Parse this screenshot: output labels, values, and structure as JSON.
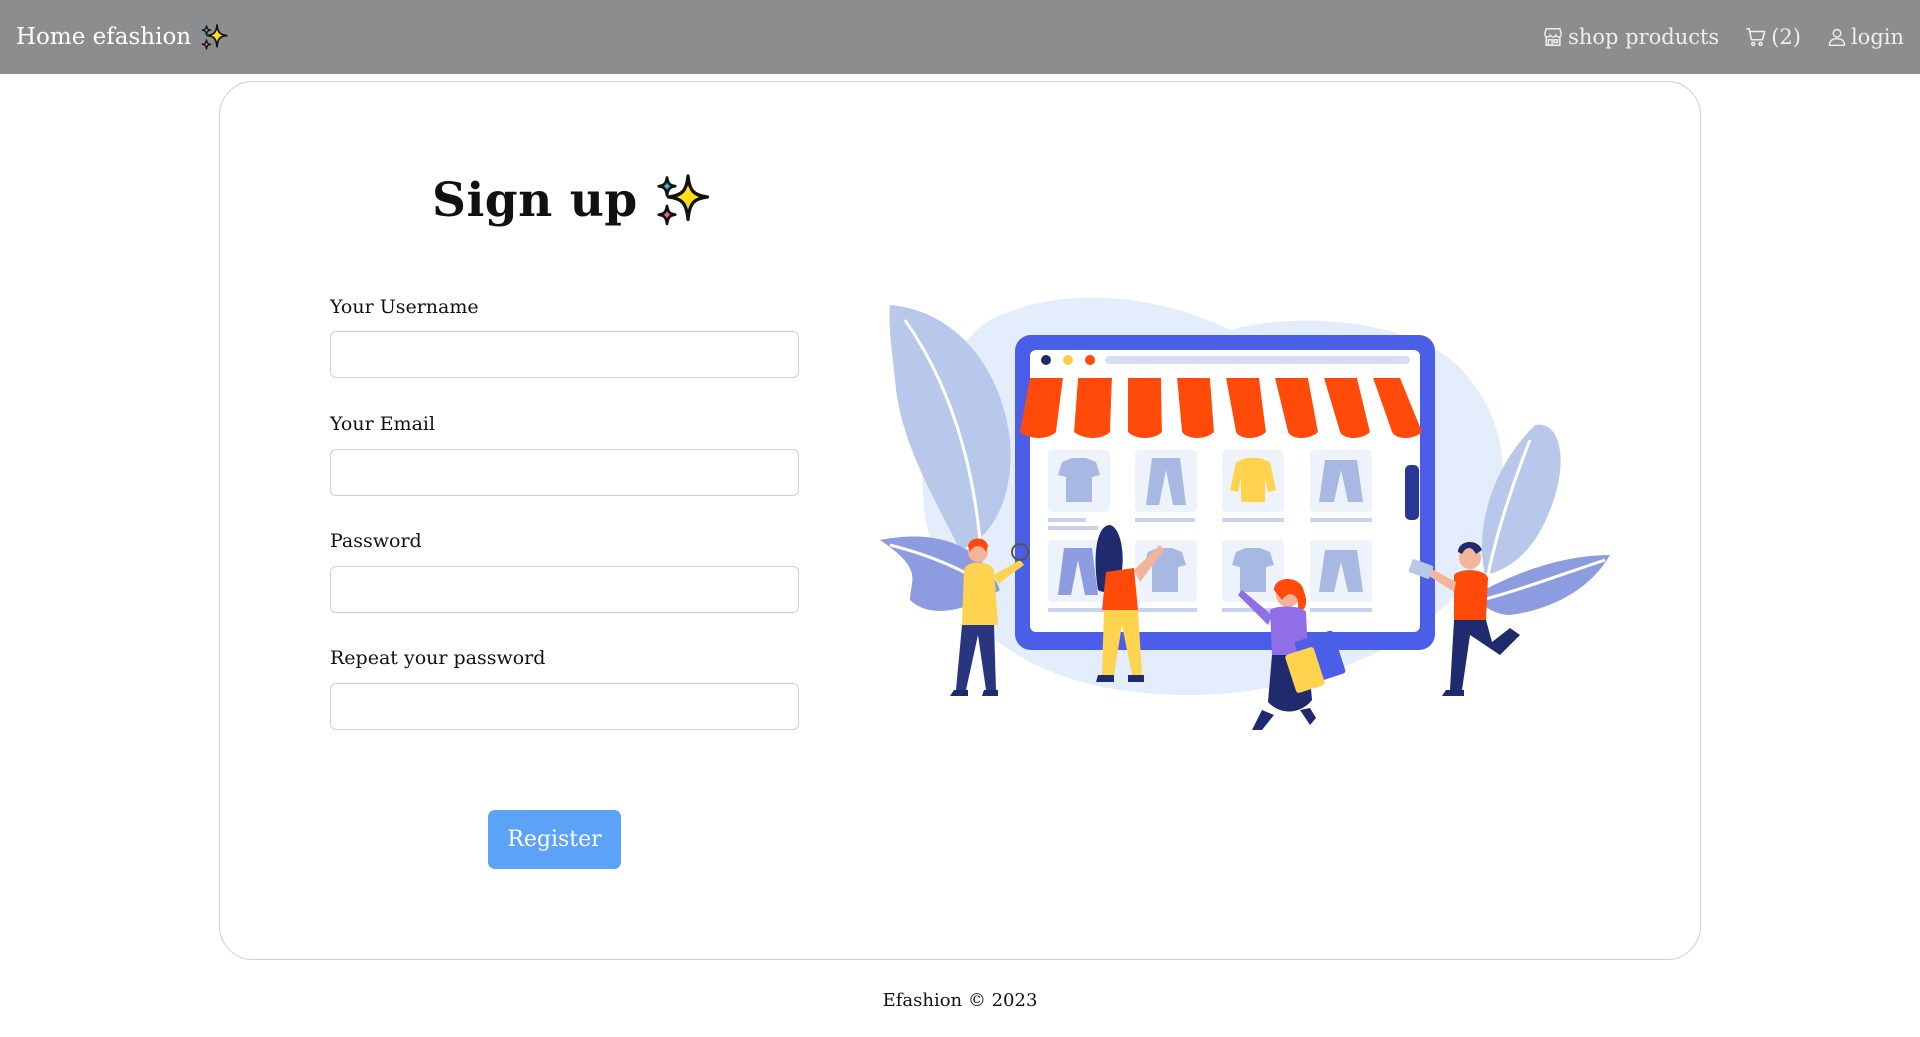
{
  "navbar": {
    "brand": "Home efashion",
    "brand_icon": "sparkles-icon",
    "shop_label": "shop products",
    "shop_icon": "store-icon",
    "cart_label": "(2)",
    "cart_icon": "cart-icon",
    "login_label": "login",
    "login_icon": "user-icon"
  },
  "form": {
    "title": "Sign up",
    "title_icon": "sparkles-icon",
    "username_label": "Your Username",
    "username_value": "",
    "email_label": "Your Email",
    "email_value": "",
    "password_label": "Password",
    "password_value": "",
    "repeat_password_label": "Repeat your password",
    "repeat_password_value": "",
    "register_label": "Register"
  },
  "illustration": {
    "icon": "online-shop-illustration"
  },
  "footer": {
    "text": "Efashion © 2023"
  },
  "colors": {
    "navbar": "#8c8d8f",
    "button": "#5ca2f7",
    "awning": "#ff4a0a",
    "tablet": "#4a5ee8"
  }
}
